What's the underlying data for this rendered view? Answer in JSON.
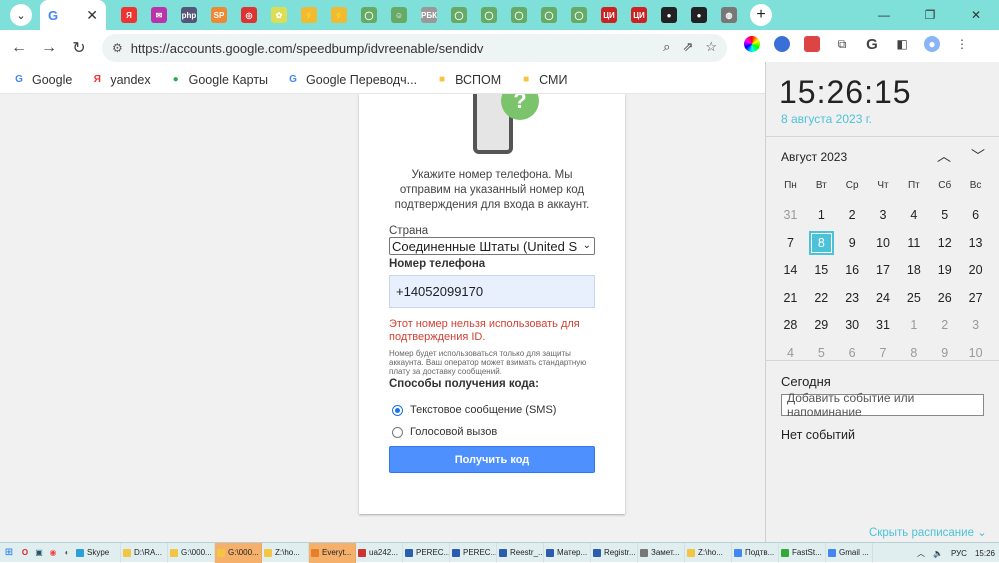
{
  "window": {
    "minimize": "—",
    "restore": "❐",
    "close": "✕"
  },
  "tabs": {
    "active_icon": "G",
    "active_close": "✕",
    "new_tab": "+"
  },
  "favicons": [
    {
      "name": "yandex",
      "c": "#e33",
      "t": "Я"
    },
    {
      "name": "mail",
      "c": "#b3a",
      "t": "✉"
    },
    {
      "name": "php",
      "c": "#557",
      "t": "php"
    },
    {
      "name": "sp",
      "c": "#e83",
      "t": "SP"
    },
    {
      "name": "ring",
      "c": "#d33",
      "t": "◎"
    },
    {
      "name": "star",
      "c": "#dd5",
      "t": "✿"
    },
    {
      "name": "runner",
      "c": "#eb3",
      "t": "⚡"
    },
    {
      "name": "runner2",
      "c": "#eb3",
      "t": "⚡"
    },
    {
      "name": "g1",
      "c": "#6a6",
      "t": "◯"
    },
    {
      "name": "g2",
      "c": "#6a6",
      "t": "☺"
    },
    {
      "name": "rbc",
      "c": "#999",
      "t": "РБК"
    },
    {
      "name": "g3",
      "c": "#6a6",
      "t": "◯"
    },
    {
      "name": "g4",
      "c": "#6a6",
      "t": "◯"
    },
    {
      "name": "g5",
      "c": "#6a6",
      "t": "◯"
    },
    {
      "name": "g6",
      "c": "#6a6",
      "t": "◯"
    },
    {
      "name": "g7",
      "c": "#6a6",
      "t": "◯"
    },
    {
      "name": "cian1",
      "c": "#c22",
      "t": "ЦИ"
    },
    {
      "name": "cian2",
      "c": "#c22",
      "t": "ЦИ"
    },
    {
      "name": "spy1",
      "c": "#222",
      "t": "●"
    },
    {
      "name": "spy2",
      "c": "#222",
      "t": "●"
    },
    {
      "name": "globe",
      "c": "#777",
      "t": "◍"
    }
  ],
  "toolbar": {
    "back": "←",
    "forward": "→",
    "reload": "↻",
    "site_info": "⚙",
    "url": "https://accounts.google.com/speedbump/idvreenable/sendidv"
  },
  "bookmarks": [
    {
      "label": "Google",
      "icon": "G",
      "color": "#4285f4"
    },
    {
      "label": "yandex",
      "icon": "Я",
      "color": "#e33"
    },
    {
      "label": "Google Карты",
      "icon": "●",
      "color": "#34a853"
    },
    {
      "label": "Google Переводч...",
      "icon": "G",
      "color": "#4285f4"
    },
    {
      "label": "ВСПОМ",
      "icon": "■",
      "color": "#f4c542"
    },
    {
      "label": "СМИ",
      "icon": "■",
      "color": "#f4c542"
    }
  ],
  "form": {
    "description": "Укажите номер телефона. Мы отправим на указанный номер код подтверждения для входа в аккаунт.",
    "country_label": "Страна",
    "country_value": "Соединенные Штаты (United S",
    "phone_label": "Номер телефона",
    "phone_value": "+14052099170",
    "error": "Этот номер нельзя использовать для подтверждения ID.",
    "note": "Номер будет использоваться только для защиты аккаунта. Ваш оператор может взимать стандартную плату за доставку сообщений.",
    "methods_label": "Способы получения кода:",
    "sms_label": "Текстовое сообщение (SMS)",
    "voice_label": "Голосовой вызов",
    "submit": "Получить код"
  },
  "calendar": {
    "time": "15:26:15",
    "date": "8 августа 2023 г.",
    "month": "Август 2023",
    "weekdays": [
      "Пн",
      "Вт",
      "Ср",
      "Чт",
      "Пт",
      "Сб",
      "Вс"
    ],
    "weeks": [
      [
        "31",
        "1",
        "2",
        "3",
        "4",
        "5",
        "6"
      ],
      [
        "7",
        "8",
        "9",
        "10",
        "11",
        "12",
        "13"
      ],
      [
        "14",
        "15",
        "16",
        "17",
        "18",
        "19",
        "20"
      ],
      [
        "21",
        "22",
        "23",
        "24",
        "25",
        "26",
        "27"
      ],
      [
        "28",
        "29",
        "30",
        "31",
        "1",
        "2",
        "3"
      ],
      [
        "4",
        "5",
        "6",
        "7",
        "8",
        "9",
        "10"
      ]
    ],
    "today_label": "Сегодня",
    "event_placeholder": "Добавить событие или напоминание",
    "no_events": "Нет событий",
    "schedule": "Скрыть расписание ⌄"
  },
  "taskbar": {
    "items": [
      {
        "label": "Skype",
        "c": "#2a9fd8"
      },
      {
        "label": "D:\\RA...",
        "c": "#f4c542"
      },
      {
        "label": "G:\\000...",
        "c": "#f4c542"
      },
      {
        "label": "G:\\000...",
        "c": "#f4c542",
        "active": true
      },
      {
        "label": "Z:\\ho...",
        "c": "#f4c542"
      },
      {
        "label": "Everyt...",
        "c": "#e87d2a",
        "active": true
      },
      {
        "label": "ua242...",
        "c": "#c33"
      },
      {
        "label": "PEREC...",
        "c": "#2a5db0"
      },
      {
        "label": "PEREC...",
        "c": "#2a5db0"
      },
      {
        "label": "Reestr_...",
        "c": "#2a5db0"
      },
      {
        "label": "Матер...",
        "c": "#2a5db0"
      },
      {
        "label": "Registr...",
        "c": "#2a5db0"
      },
      {
        "label": "Замет...",
        "c": "#777"
      },
      {
        "label": "Z:\\ho...",
        "c": "#f4c542"
      },
      {
        "label": "Подтв...",
        "c": "#4285f4"
      },
      {
        "label": "FastSt...",
        "c": "#3a3"
      },
      {
        "label": "Gmail ...",
        "c": "#4285f4"
      }
    ],
    "lang": "РУС",
    "time": "15:26"
  }
}
